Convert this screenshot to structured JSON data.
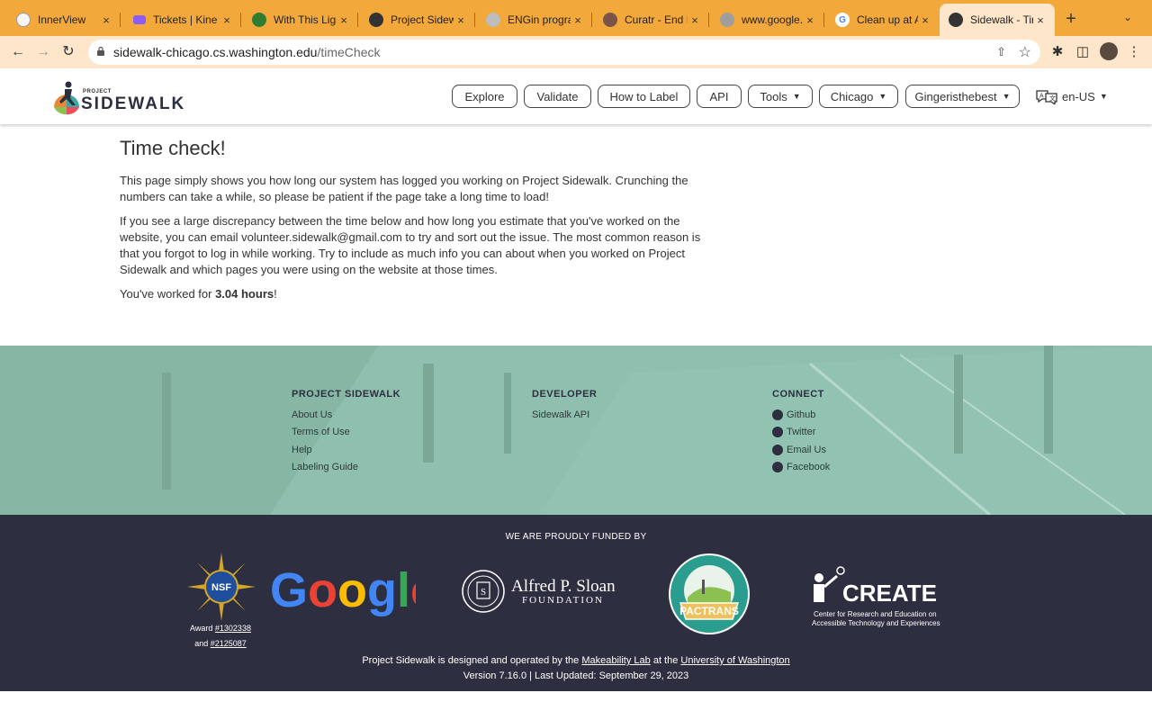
{
  "browser": {
    "tabs": [
      {
        "title": "InnerView",
        "color": "#f1f1f1"
      },
      {
        "title": "Tickets | Kine",
        "color": "#8b5cf6"
      },
      {
        "title": "With This Ligi",
        "color": "#2e7d32"
      },
      {
        "title": "Project Sidew",
        "color": "#333333"
      },
      {
        "title": "ENGin progra",
        "color": "#9e9e9e"
      },
      {
        "title": "Curatr - End I",
        "color": "#795548"
      },
      {
        "title": "www.google.",
        "color": "#9e9e9e"
      },
      {
        "title": "Clean up at A",
        "color": "#4285f4"
      },
      {
        "title": "Sidewalk - Tir",
        "color": "#333333"
      }
    ],
    "tab_close": "×",
    "new_tab": "+",
    "tab_menu": "⌄",
    "url_host": "sidewalk-chicago.cs.washington.edu",
    "url_path": "/timeCheck"
  },
  "site": {
    "logo_small": "PROJECT",
    "logo_big": "SIDEWALK",
    "nav": {
      "explore": "Explore",
      "validate": "Validate",
      "how_to_label": "How to Label",
      "api": "API",
      "tools": "Tools",
      "city": "Chicago",
      "user": "Gingeristhebest"
    },
    "lang": "en-US"
  },
  "main": {
    "title": "Time check!",
    "para1": "This page simply shows you how long our system has logged you working on Project Sidewalk. Crunching the numbers can take a while, so please be patient if the page take a long time to load!",
    "para2": "If you see a large discrepancy between the time below and how long you estimate that you've worked on the website, you can email volunteer.sidewalk@gmail.com to try and sort out the issue. The most common reason is that you forgot to log in while working. Try to include as much info you can about when you worked on Project Sidewalk and which pages you were using on the website at those times.",
    "worked_prefix": "You've worked for ",
    "worked_hours": "3.04 hours",
    "worked_suffix": "!"
  },
  "footer": {
    "col1": {
      "heading": "PROJECT SIDEWALK",
      "links": [
        "About Us",
        "Terms of Use",
        "Help",
        "Labeling Guide"
      ]
    },
    "col2": {
      "heading": "DEVELOPER",
      "links": [
        "Sidewalk API"
      ]
    },
    "col3": {
      "heading": "CONNECT",
      "links": [
        "Github",
        "Twitter",
        "Email Us",
        "Facebook"
      ]
    },
    "funded_by": "WE ARE PROUDLY FUNDED BY",
    "sponsors": {
      "nsf": "NSF",
      "google": "Google",
      "sloan_line1": "Alfred P. Sloan",
      "sloan_line2": "FOUNDATION",
      "pactrans": "PACTRANS",
      "create": "CREATE",
      "create_sub1": "Center for Research and Education on",
      "create_sub2": "Accessible Technology and Experiences"
    },
    "award_prefix": "Award ",
    "award1": "#1302338",
    "award_and": "and ",
    "award2": "#2125087",
    "credits_prefix": "Project Sidewalk is designed and operated by the ",
    "credits_lab": "Makeability Lab",
    "credits_mid": " at the ",
    "credits_uni": "University of Washington",
    "version": "Version 7.16.0 | Last Updated: September 29, 2023"
  },
  "colors": {
    "tabbar": "#f2a83a",
    "toolbar": "#fde6c9",
    "footer_green": "#8dbdac",
    "footer_dark": "#2d2f40"
  }
}
